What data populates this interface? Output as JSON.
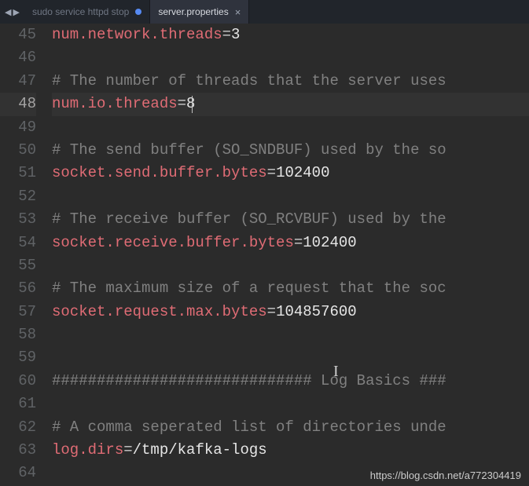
{
  "tabs": {
    "nav_left": "◀",
    "nav_right": "▶",
    "items": [
      {
        "label": "sudo service httpd stop",
        "active": false,
        "modified": true
      },
      {
        "label": "server.properties",
        "active": true,
        "modified": false
      }
    ]
  },
  "editor": {
    "first_line_number": 45,
    "current_line_number": 48,
    "text_cursor_glyph": "I",
    "lines": [
      {
        "type": "prop",
        "key": "num.network.threads",
        "eq": "=",
        "value": "3"
      },
      {
        "type": "blank"
      },
      {
        "type": "comment",
        "text": "# The number of threads that the server uses"
      },
      {
        "type": "prop",
        "key": "num.io.threads",
        "eq": "=",
        "value": "8",
        "caret_after": true
      },
      {
        "type": "blank"
      },
      {
        "type": "comment",
        "text": "# The send buffer (SO_SNDBUF) used by the so"
      },
      {
        "type": "prop",
        "key": "socket.send.buffer.bytes",
        "eq": "=",
        "value": "102400"
      },
      {
        "type": "blank"
      },
      {
        "type": "comment",
        "text": "# The receive buffer (SO_RCVBUF) used by the"
      },
      {
        "type": "prop",
        "key": "socket.receive.buffer.bytes",
        "eq": "=",
        "value": "102400"
      },
      {
        "type": "blank"
      },
      {
        "type": "comment",
        "text": "# The maximum size of a request that the soc"
      },
      {
        "type": "prop",
        "key": "socket.request.max.bytes",
        "eq": "=",
        "value": "104857600"
      },
      {
        "type": "blank"
      },
      {
        "type": "blank"
      },
      {
        "type": "comment",
        "text": "############################# Log Basics ###"
      },
      {
        "type": "blank"
      },
      {
        "type": "comment",
        "text": "# A comma seperated list of directories unde"
      },
      {
        "type": "prop",
        "key": "log.dirs",
        "eq": "=",
        "value": "/tmp/kafka-logs"
      },
      {
        "type": "blank"
      }
    ]
  },
  "watermark": "https://blog.csdn.net/a772304419",
  "close_glyph": "×"
}
